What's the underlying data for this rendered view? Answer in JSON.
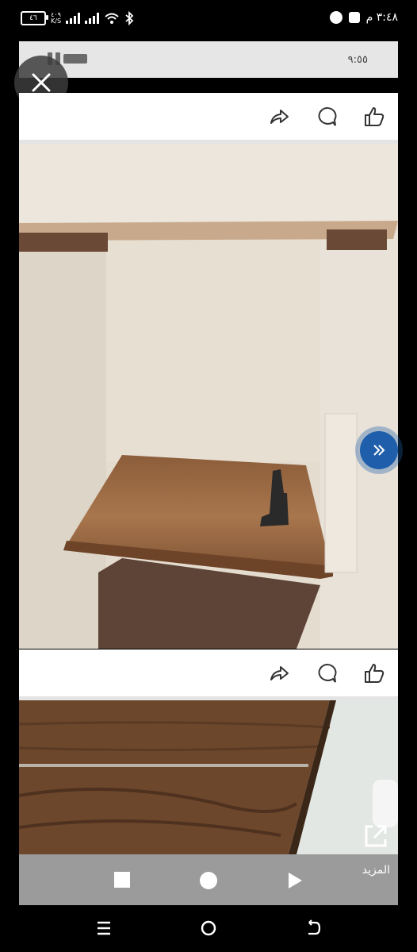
{
  "status_bar": {
    "battery": "٤٦",
    "network_rate": "٤٠٩",
    "network_unit": "K/S",
    "time": "٣:٤٨ م"
  },
  "inner_status": {
    "time": "٩:٥٥"
  },
  "bottom_bar": {
    "more_label": "المزيد"
  },
  "colors": {
    "accent": "#1e5eaa",
    "bottom_bar": "#9b9b9b",
    "wood": "#9a6b45"
  }
}
